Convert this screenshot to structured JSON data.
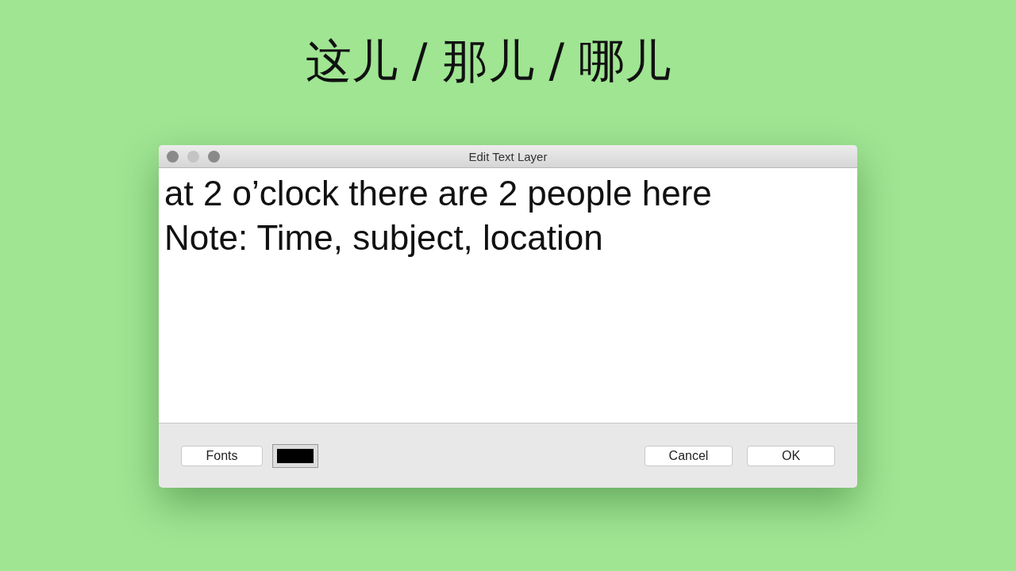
{
  "heading": "这儿 / 那儿 / 哪儿",
  "window": {
    "title": "Edit Text Layer"
  },
  "text_area": {
    "lines": [
      "at 2 o’clock there are 2 people here",
      "Note: Time, subject, location"
    ]
  },
  "footer": {
    "fonts_button": "Fonts",
    "color_well": {
      "color": "#000000"
    },
    "buttons": [
      "Cancel",
      "OK"
    ]
  }
}
